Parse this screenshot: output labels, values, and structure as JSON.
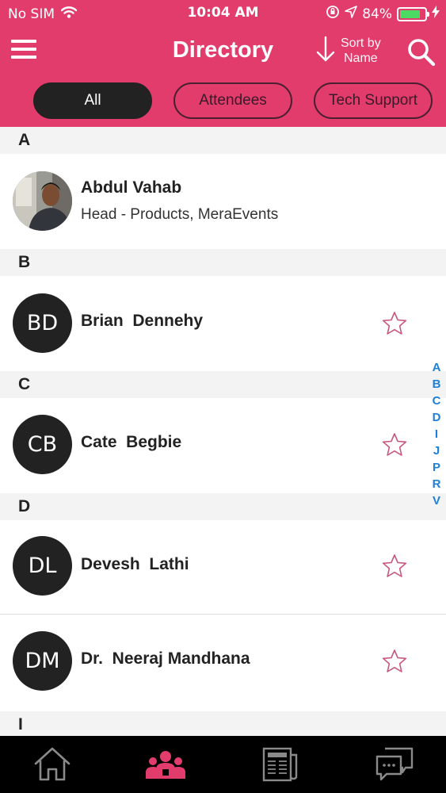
{
  "status_bar": {
    "carrier": "No SIM",
    "time": "10:04 AM",
    "battery_percent": "84%",
    "battery_level": 0.84,
    "icons": [
      "wifi-icon",
      "orientation-lock-icon",
      "location-arrow-icon",
      "battery-icon",
      "charging-bolt-icon"
    ]
  },
  "navbar": {
    "title": "Directory",
    "sort_line1": "Sort by",
    "sort_line2": "Name",
    "icons": [
      "hamburger-menu-icon",
      "sort-down-arrow-icon",
      "search-icon"
    ]
  },
  "filters": [
    {
      "label": "All",
      "active": true
    },
    {
      "label": "Attendees",
      "active": false
    },
    {
      "label": "Tech Support",
      "active": false
    }
  ],
  "sections": [
    {
      "letter": "A",
      "people": [
        {
          "name": "Abdul Vahab",
          "subtitle": "Head - Products, MeraEvents",
          "initials": "",
          "has_photo": true,
          "starred": null
        }
      ]
    },
    {
      "letter": "B",
      "people": [
        {
          "name": "Brian  Dennehy",
          "subtitle": "",
          "initials": "BD",
          "has_photo": false,
          "starred": false
        }
      ]
    },
    {
      "letter": "C",
      "people": [
        {
          "name": "Cate  Begbie",
          "subtitle": "",
          "initials": "CB",
          "has_photo": false,
          "starred": false
        }
      ]
    },
    {
      "letter": "D",
      "people": [
        {
          "name": "Devesh  Lathi",
          "subtitle": "",
          "initials": "DL",
          "has_photo": false,
          "starred": false
        },
        {
          "name": "Dr.  Neeraj Mandhana",
          "subtitle": "",
          "initials": "DM",
          "has_photo": false,
          "starred": false
        }
      ]
    },
    {
      "letter": "I",
      "people": []
    }
  ],
  "index_letters": [
    "A",
    "B",
    "C",
    "D",
    "I",
    "J",
    "P",
    "R",
    "V"
  ],
  "tab_bar": {
    "tabs": [
      {
        "icon": "home-icon",
        "active": false
      },
      {
        "icon": "people-icon",
        "active": true
      },
      {
        "icon": "newspaper-icon",
        "active": false
      },
      {
        "icon": "chat-bubbles-icon",
        "active": false
      }
    ]
  },
  "colors": {
    "brand": "#e23c6d",
    "active_chip": "#222222",
    "index_blue": "#1f7fd8",
    "star_outline": "#c8567f",
    "tab_active": "#e23c6d",
    "tab_inactive": "#8a8a8a"
  }
}
